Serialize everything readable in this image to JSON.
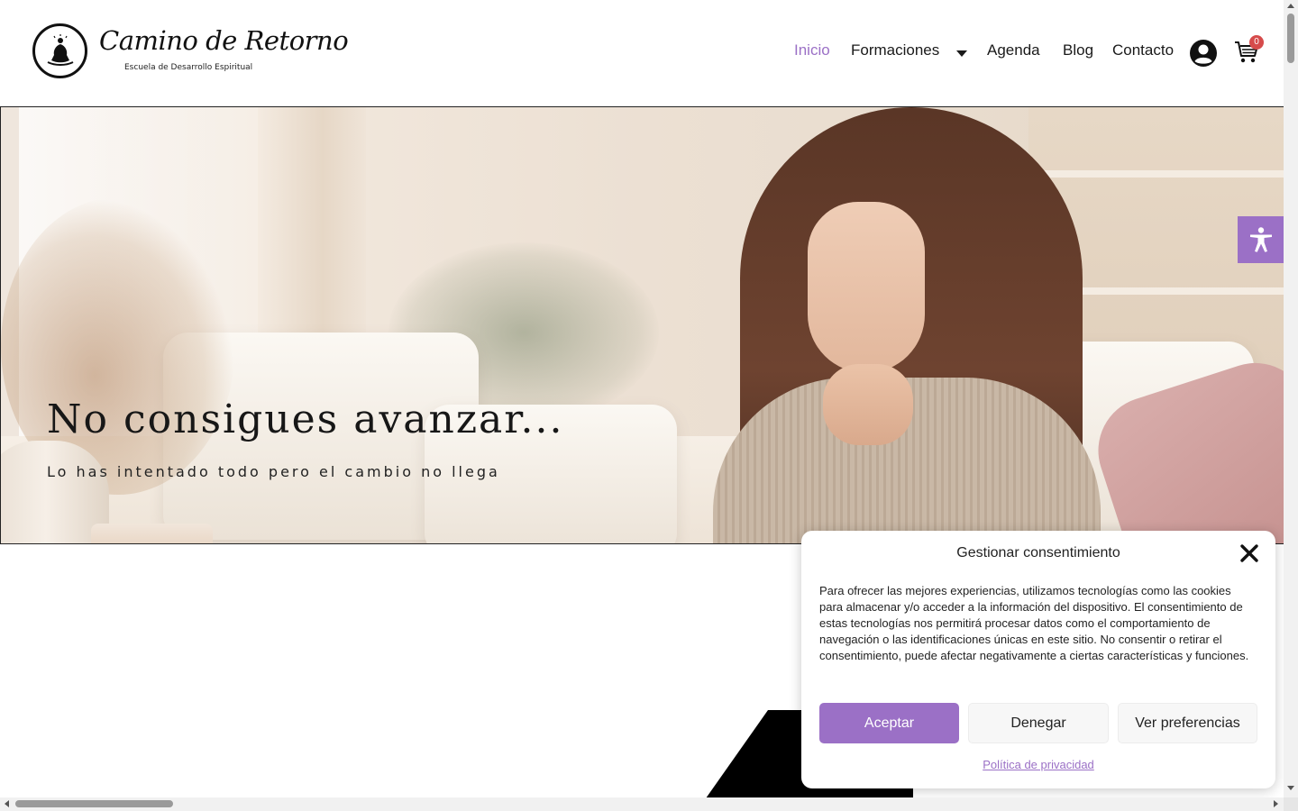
{
  "header": {
    "logo": {
      "icon": "meditation-figure-icon",
      "title": "Camino de Retorno",
      "subtitle": "Escuela de Desarrollo Espiritual"
    },
    "nav": [
      {
        "label": "Inicio",
        "active": true
      },
      {
        "label": "Formaciones",
        "has_dropdown": true
      },
      {
        "label": "Agenda"
      },
      {
        "label": "Blog"
      },
      {
        "label": "Contacto"
      }
    ],
    "user_icon": "user-circle-icon",
    "cart": {
      "icon": "cart-icon",
      "count": "0"
    }
  },
  "hero": {
    "title": "No consigues avanzar...",
    "subtitle": "Lo has intentado todo pero el cambio no llega"
  },
  "accessibility": {
    "icon": "accessibility-icon"
  },
  "consent": {
    "title": "Gestionar consentimiento",
    "body": "Para ofrecer las mejores experiencias, utilizamos tecnologías como las cookies para almacenar y/o acceder a la información del dispositivo. El consentimiento de estas tecnologías nos permitirá procesar datos como el comportamiento de navegación o las identificaciones únicas en este sitio. No consentir o retirar el consentimiento, puede afectar negativamente a ciertas características y funciones.",
    "accept_label": "Aceptar",
    "deny_label": "Denegar",
    "prefs_label": "Ver preferencias",
    "privacy_link": "Política de privacidad"
  },
  "colors": {
    "accent": "#9b70c6",
    "badge": "#d64b4b",
    "text": "#1a1a1a"
  }
}
